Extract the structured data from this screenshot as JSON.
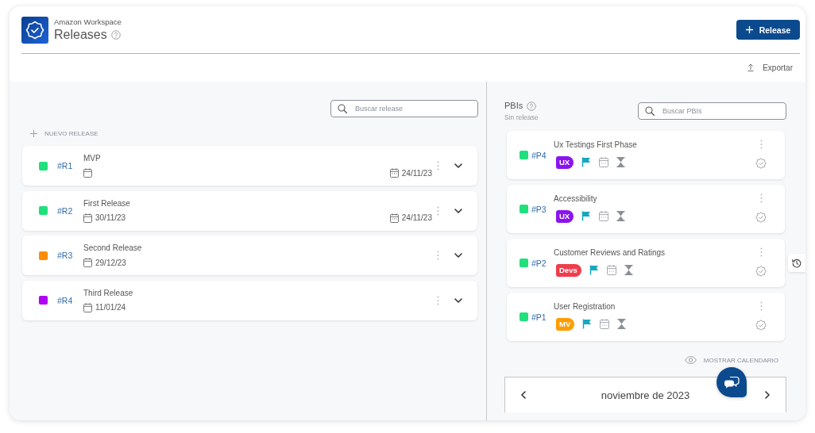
{
  "header": {
    "workspace": "Amazon Workspace",
    "title": "Releases",
    "primary_button": "Release",
    "export": "Exportar"
  },
  "releases": {
    "search": {
      "placeholder": "Buscar release"
    },
    "new_release": "NUEVO RELEASE",
    "items": [
      {
        "code": "#R1",
        "name": "MVP",
        "color": "#1fe07c",
        "end_date": "24/11/23"
      },
      {
        "code": "#R2",
        "name": "First Release",
        "color": "#1fe07c",
        "start_date": "30/11/23",
        "end_date": "24/11/23"
      },
      {
        "code": "#R3",
        "name": "Second Release",
        "color": "#ff8c00",
        "start_date": "29/12/23"
      },
      {
        "code": "#R4",
        "name": "Third Release",
        "color": "#b000f5",
        "start_date": "11/01/24"
      }
    ]
  },
  "pbis": {
    "title": "PBIs",
    "subtitle": "Sin release",
    "search": {
      "placeholder": "Buscar PBIs"
    },
    "items": [
      {
        "code": "#P4",
        "name": "Ux Testings First Phase",
        "color": "#1fe07c",
        "tag": {
          "label": "UX",
          "color": "#8a14f0"
        }
      },
      {
        "code": "#P3",
        "name": "Accessibility",
        "color": "#1fe07c",
        "tag": {
          "label": "UX",
          "color": "#8a14f0"
        }
      },
      {
        "code": "#P2",
        "name": "Customer Reviews and Ratings",
        "color": "#1fe07c",
        "tag": {
          "label": "Devs",
          "color": "#f03c4c"
        }
      },
      {
        "code": "#P1",
        "name": "User Registration",
        "color": "#1fe07c",
        "tag": {
          "label": "MV",
          "color": "#ff9c00"
        }
      }
    ]
  },
  "calendar": {
    "toggle": "MOSTRAR CALENDARIO",
    "month": "noviembre de 2023"
  }
}
